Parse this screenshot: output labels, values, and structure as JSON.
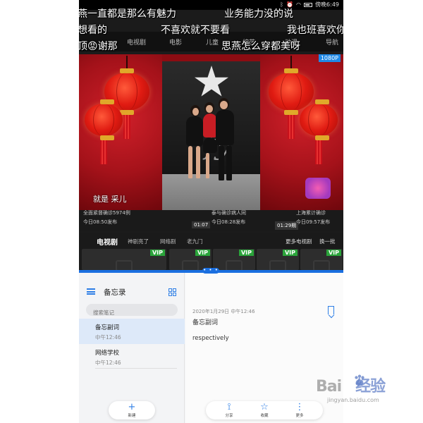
{
  "status_bar": {
    "time": "傍晚6:49"
  },
  "video_app": {
    "nav_tabs": [
      "电视剧",
      "电影",
      "儿童",
      "综艺",
      "动漫",
      "导航"
    ],
    "danmaku": [
      "燕一直都是那么有魅力",
      "业务能力没的说",
      "想看的",
      "不喜欢就不要看",
      "我也班喜欢你",
      "顶😡谢那",
      "思燕怎么穿都美呀"
    ],
    "resolution_badge": "1080P",
    "subtitle": "就是  采儿",
    "info_cards": [
      {
        "title": "全面紧督确诊5974例",
        "time": "今日08:50发布"
      },
      {
        "title": "泰与确诊病人同",
        "time": "今日08:28发布",
        "duration": "01:07"
      },
      {
        "title": "上海累计确诊",
        "time": "今日09:57发布",
        "duration": "01:29期"
      }
    ],
    "section": {
      "title": "电视剧",
      "tags": [
        "神剧亮了",
        "网络剧",
        "老九门"
      ],
      "more": "更多电视剧",
      "refresh": "换一批"
    },
    "thumbs_badge": "VIP",
    "drag_handle": "• • •"
  },
  "notes_app": {
    "title": "备忘录",
    "search_placeholder": "搜索笔记",
    "notes": [
      {
        "title": "备忘副词",
        "time": "中午12:46"
      },
      {
        "title": "网络学校",
        "time": "中午12:46"
      }
    ],
    "detail": {
      "date": "2020年1月29日 中午12:46",
      "heading": "备忘副词",
      "body": "respectively"
    },
    "new_button": {
      "glyph": "+",
      "label": "新建"
    },
    "actions": [
      {
        "glyph": "⟟",
        "label": "分享",
        "icon": "share-icon"
      },
      {
        "glyph": "☆",
        "label": "收藏",
        "icon": "star-icon"
      },
      {
        "glyph": "⋮",
        "label": "更多",
        "icon": "more-icon"
      }
    ]
  },
  "watermark": {
    "brand_a": "Bai",
    "brand_b": "经验",
    "sub": "jingyan.baidu.com"
  }
}
